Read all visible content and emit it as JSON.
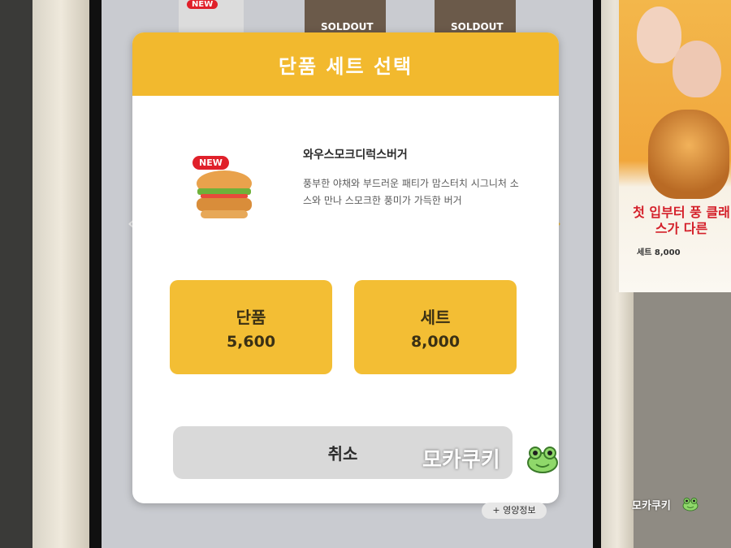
{
  "modal": {
    "title": "단품 세트 선택",
    "product": {
      "badge": "NEW",
      "name": "와우스모크디럭스버거",
      "description": "풍부한 야채와 부드러운 패티가 맘스터치 시그니처 소스와 만나 스모크한 풍미가 가득한 버거"
    },
    "options": [
      {
        "label": "단품",
        "price": "5,600"
      },
      {
        "label": "세트",
        "price": "8,000"
      }
    ],
    "cancel_label": "취소"
  },
  "background_menu": {
    "badge": "NEW",
    "soldout_labels": [
      "SOLDOUT",
      "SOLDOUT"
    ]
  },
  "nutrition_label": "+ 영양정보",
  "poster": {
    "headline": "첫 입부터 풍 클래스가 다른",
    "price": "8,000"
  },
  "watermark": "모카쿠키",
  "colors": {
    "accent": "#f2b92e",
    "button": "#f3be34",
    "cancel": "#d9d9d9",
    "badge": "#e0202a"
  }
}
